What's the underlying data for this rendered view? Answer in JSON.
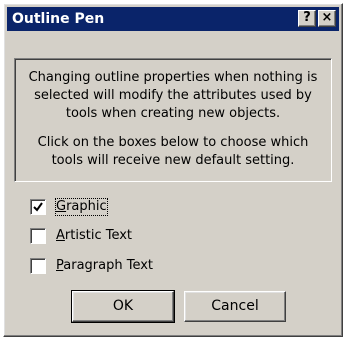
{
  "window": {
    "title": "Outline Pen",
    "help_label": "?",
    "close_label": "×",
    "titlebar_color": "#0a246a",
    "face_color": "#d4d0c8"
  },
  "info": {
    "paragraph1_lines": [
      "Changing outline properties when nothing is",
      "selected will modify the attributes used by",
      "tools when creating new objects."
    ],
    "paragraph2_lines": [
      "Click on the boxes below to choose which",
      "tools will receive new default setting."
    ]
  },
  "options": [
    {
      "mnemonic": "G",
      "rest": "raphic",
      "checked": true,
      "focused": true
    },
    {
      "mnemonic": "A",
      "rest": "rtistic Text",
      "checked": false,
      "focused": false
    },
    {
      "mnemonic": "P",
      "rest": "aragraph Text",
      "checked": false,
      "focused": false
    }
  ],
  "buttons": {
    "ok_label": "OK",
    "cancel_label": "Cancel"
  }
}
